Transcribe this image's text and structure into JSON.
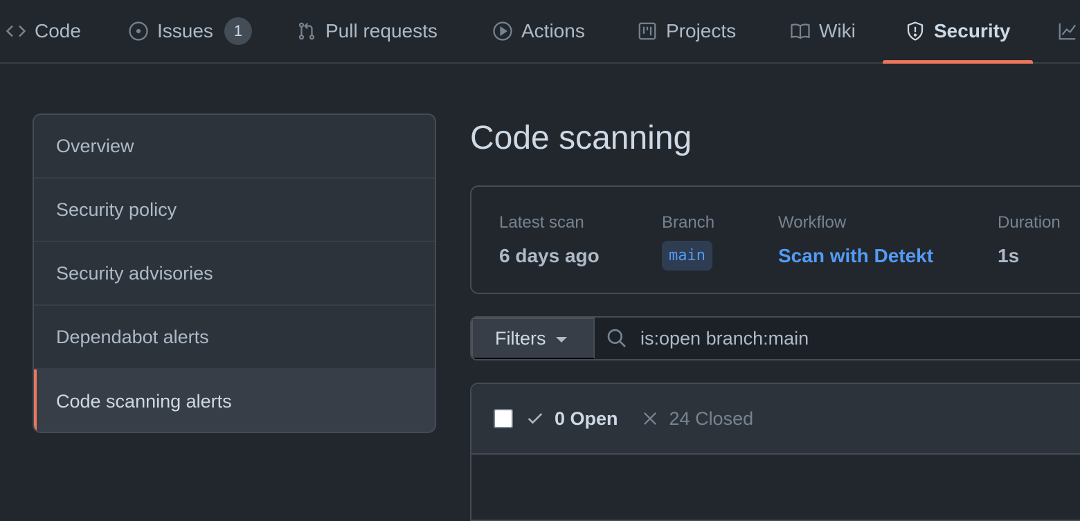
{
  "repo_nav": {
    "tabs": [
      {
        "label": "Code",
        "icon": "code-icon"
      },
      {
        "label": "Issues",
        "icon": "issue-opened-icon",
        "counter": "1"
      },
      {
        "label": "Pull requests",
        "icon": "git-pull-request-icon"
      },
      {
        "label": "Actions",
        "icon": "play-icon"
      },
      {
        "label": "Projects",
        "icon": "project-icon"
      },
      {
        "label": "Wiki",
        "icon": "book-icon"
      },
      {
        "label": "Security",
        "icon": "shield-icon",
        "selected": true
      },
      {
        "label": "",
        "icon": "graph-icon"
      }
    ]
  },
  "sidebar": {
    "items": [
      {
        "label": "Overview"
      },
      {
        "label": "Security policy"
      },
      {
        "label": "Security advisories"
      },
      {
        "label": "Dependabot alerts"
      },
      {
        "label": "Code scanning alerts",
        "selected": true
      }
    ]
  },
  "main": {
    "title": "Code scanning",
    "latest_scan": {
      "latest_label": "Latest scan",
      "latest_value": "6 days ago",
      "branch_label": "Branch",
      "branch_value": "main",
      "workflow_label": "Workflow",
      "workflow_value": "Scan with Detekt",
      "duration_label": "Duration",
      "duration_value": "1s"
    },
    "filters": {
      "button_label": "Filters",
      "search_value": "is:open branch:main"
    },
    "results": {
      "open_label": "0 Open",
      "closed_label": "24 Closed"
    }
  },
  "colors": {
    "background": "#22272e",
    "accent_underline": "#ec775c",
    "link": "#539bf5"
  }
}
